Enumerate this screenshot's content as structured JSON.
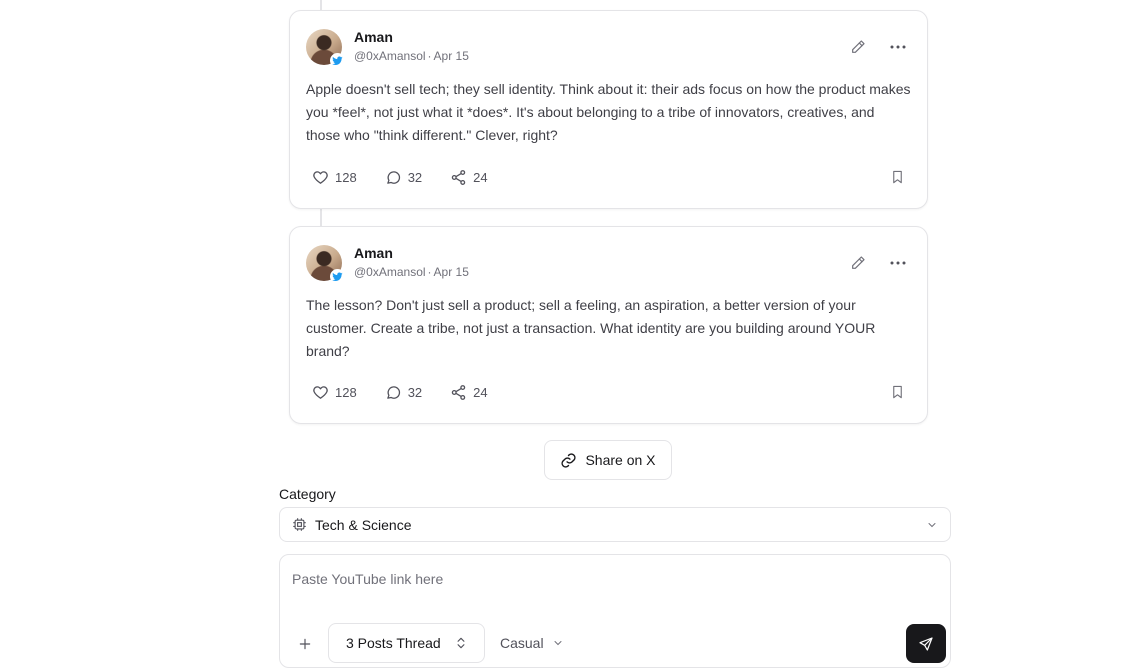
{
  "tweets": [
    {
      "name": "Aman",
      "handle": "@0xAmansol",
      "separator": "·",
      "date": "Apr 15",
      "text": "Apple doesn't sell tech; they sell identity. Think about it: their ads focus on how the product makes you *feel*, not just what it *does*. It's about belonging to a tribe of innovators, creatives, and those who \"think different.\" Clever, right?",
      "likes": "128",
      "comments": "32",
      "shares": "24"
    },
    {
      "name": "Aman",
      "handle": "@0xAmansol",
      "separator": "·",
      "date": "Apr 15",
      "text": "The lesson? Don't just sell a product; sell a feeling, an aspiration, a better version of your customer. Create a tribe, not just a transaction. What identity are you building around YOUR brand?",
      "likes": "128",
      "comments": "32",
      "shares": "24"
    }
  ],
  "share_button": "Share on X",
  "category": {
    "label": "Category",
    "value": "Tech & Science",
    "icon": "cpu-icon"
  },
  "composer": {
    "placeholder": "Paste YouTube link here",
    "thread_option": "3 Posts Thread",
    "tone_option": "Casual"
  },
  "colors": {
    "text": "#18181b",
    "muted": "#71717a",
    "border": "#e4e4e7",
    "send_button": "#18181b",
    "verified": "#1d9bf0"
  }
}
